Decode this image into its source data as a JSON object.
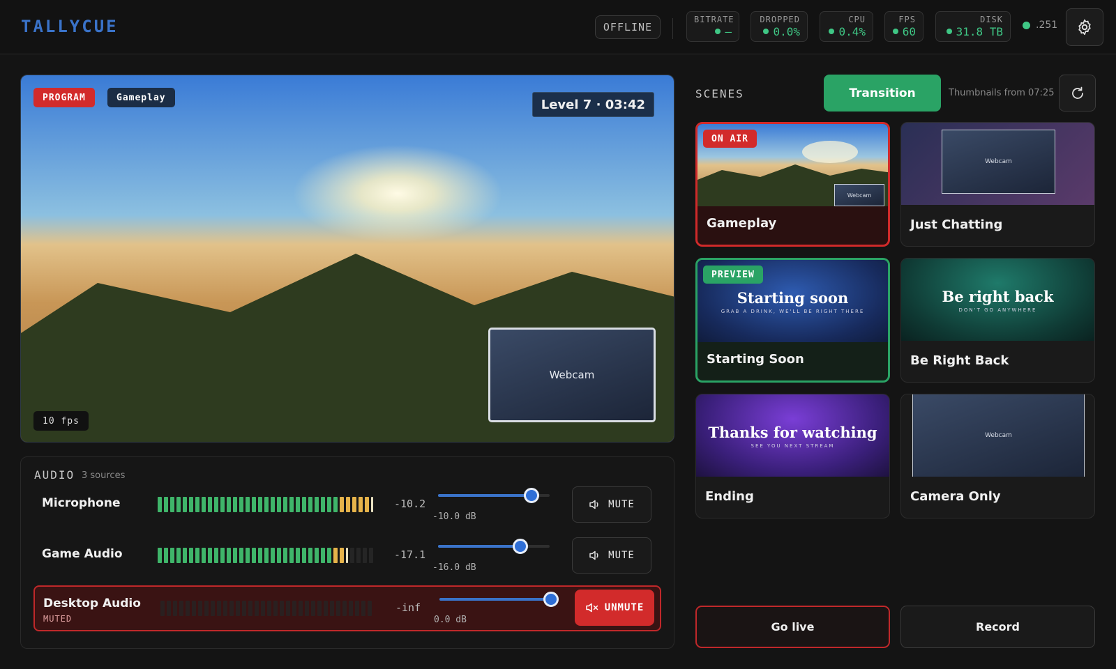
{
  "app": {
    "logo": "TALLYCUE",
    "status": "OFFLINE",
    "connection": ".251"
  },
  "stats": [
    {
      "label": "BITRATE",
      "value": "—"
    },
    {
      "label": "DROPPED",
      "value": "0.0%"
    },
    {
      "label": "CPU",
      "value": "0.4%"
    },
    {
      "label": "FPS",
      "value": "60"
    },
    {
      "label": "DISK",
      "value": "31.8 TB"
    }
  ],
  "program": {
    "badge": "PROGRAM",
    "scene": "Gameplay",
    "overlay_text": "Level 7 · 03:42",
    "webcam_label": "Webcam",
    "fps": "10 fps"
  },
  "audio": {
    "title": "AUDIO",
    "subtitle": "3 sources",
    "sources": [
      {
        "name": "Microphone",
        "level_text": "-10.2",
        "slider_label": "-10.0 dB",
        "slider_fraction": 0.84,
        "meter_green": 29,
        "meter_yellow": 6,
        "button": "MUTE",
        "muted": false
      },
      {
        "name": "Game Audio",
        "level_text": "-17.1",
        "slider_label": "-16.0 dB",
        "slider_fraction": 0.74,
        "meter_green": 28,
        "meter_yellow": 2,
        "button": "MUTE",
        "muted": false
      },
      {
        "name": "Desktop Audio",
        "muted_label": "MUTED",
        "level_text": "-inf",
        "slider_label": "0.0 dB",
        "slider_fraction": 1.0,
        "meter_green": 0,
        "meter_yellow": 0,
        "button": "UNMUTE",
        "muted": true
      }
    ]
  },
  "scenes": {
    "title": "SCENES",
    "transition_label": "Transition",
    "thumbnails_note": "Thumbnails from 07:25",
    "items": [
      {
        "name": "Gameplay",
        "tag": "ON AIR",
        "mini_webcam": "Webcam"
      },
      {
        "name": "Just Chatting",
        "mini_webcam": "Webcam"
      },
      {
        "name": "Starting Soon",
        "tag": "PREVIEW",
        "thumb_title": "Starting soon",
        "thumb_sub": "GRAB A DRINK, WE'LL BE RIGHT THERE"
      },
      {
        "name": "Be Right Back",
        "thumb_title": "Be right back",
        "thumb_sub": "DON'T GO ANYWHERE"
      },
      {
        "name": "Ending",
        "thumb_title": "Thanks for watching",
        "thumb_sub": "SEE YOU NEXT STREAM"
      },
      {
        "name": "Camera Only",
        "mini_webcam": "Webcam"
      }
    ]
  },
  "actions": {
    "go_live": "Go live",
    "record": "Record"
  },
  "colors": {
    "accent_blue": "#3a73c9",
    "live_red": "#d22b2b",
    "preview_green": "#2aa365",
    "meter_green": "#3fb56a",
    "meter_yellow": "#e6b34a"
  }
}
